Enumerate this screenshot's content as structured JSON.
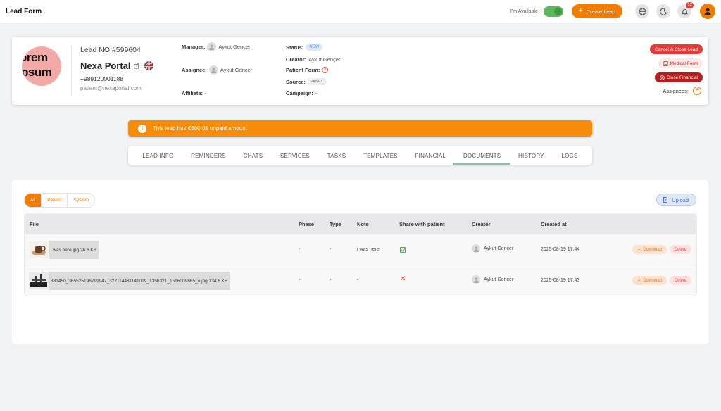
{
  "app": {
    "title": "Lead Form"
  },
  "topbar": {
    "availability_label": "I'm Available",
    "availability_on": true,
    "create_lead_label": "Create Lead",
    "notification_count": "12",
    "accent": "#f07c00"
  },
  "lead": {
    "logo_line1": "orem",
    "logo_line2": "psum",
    "number": "Lead NO #599604",
    "name": "Nexa Portal",
    "phone": "+989120001188",
    "email": "patient@nexaportal.com",
    "manager_label": "Manager:",
    "manager": "Aykut Gençer",
    "assignee_label": "Assignee:",
    "assignee": "Aykut Gençer",
    "affiliate_label": "Affiliate:",
    "affiliate": "-",
    "status_label": "Status:",
    "status": "NEW",
    "creator_label": "Creator:",
    "creator": "Aykut Gençer",
    "patient_form_label": "Patient Form:",
    "source_label": "Source:",
    "source": "PANEL",
    "campaign_label": "Campaign:",
    "campaign": "-",
    "cancel_close_label": "Cancel & Close Lead",
    "medical_form_label": "Medical Form",
    "close_financial_label": "Close Financial",
    "assignees_label": "Assignees:"
  },
  "alert": {
    "text": "This lead has €500.05 unpaid amount"
  },
  "tabs": [
    {
      "label": "LEAD INFO"
    },
    {
      "label": "REMINDERS"
    },
    {
      "label": "CHATS"
    },
    {
      "label": "SERVICES"
    },
    {
      "label": "TASKS"
    },
    {
      "label": "TEMPLATES"
    },
    {
      "label": "FINANCIAL"
    },
    {
      "label": "DOCUMENTS",
      "active": true
    },
    {
      "label": "HISTORY"
    },
    {
      "label": "LOGS"
    }
  ],
  "documents": {
    "filters": [
      {
        "label": "All",
        "active": true
      },
      {
        "label": "Patient"
      },
      {
        "label": "System"
      }
    ],
    "upload_label": "Upload",
    "columns": [
      "File",
      "Phase",
      "Type",
      "Note",
      "Share with patient",
      "Creator",
      "Created at"
    ],
    "rows": [
      {
        "file": "i was here.jpg 26.6 KB",
        "phase": "-",
        "type": "-",
        "note": "i was here",
        "shared": true,
        "creator": "Aykut Gençer",
        "created_at": "2025-08-19 17:44",
        "download_label": "Download",
        "delete_label": "Delete"
      },
      {
        "file": "331450_365525196799947_322114481141019_1356321_1516009865_o.jpg 134.6 KB",
        "phase": "-",
        "type": "-",
        "note": "-",
        "shared": false,
        "creator": "Aykut Gençer",
        "created_at": "2025-08-19 17:43",
        "download_label": "Download",
        "delete_label": "Delete"
      }
    ]
  }
}
